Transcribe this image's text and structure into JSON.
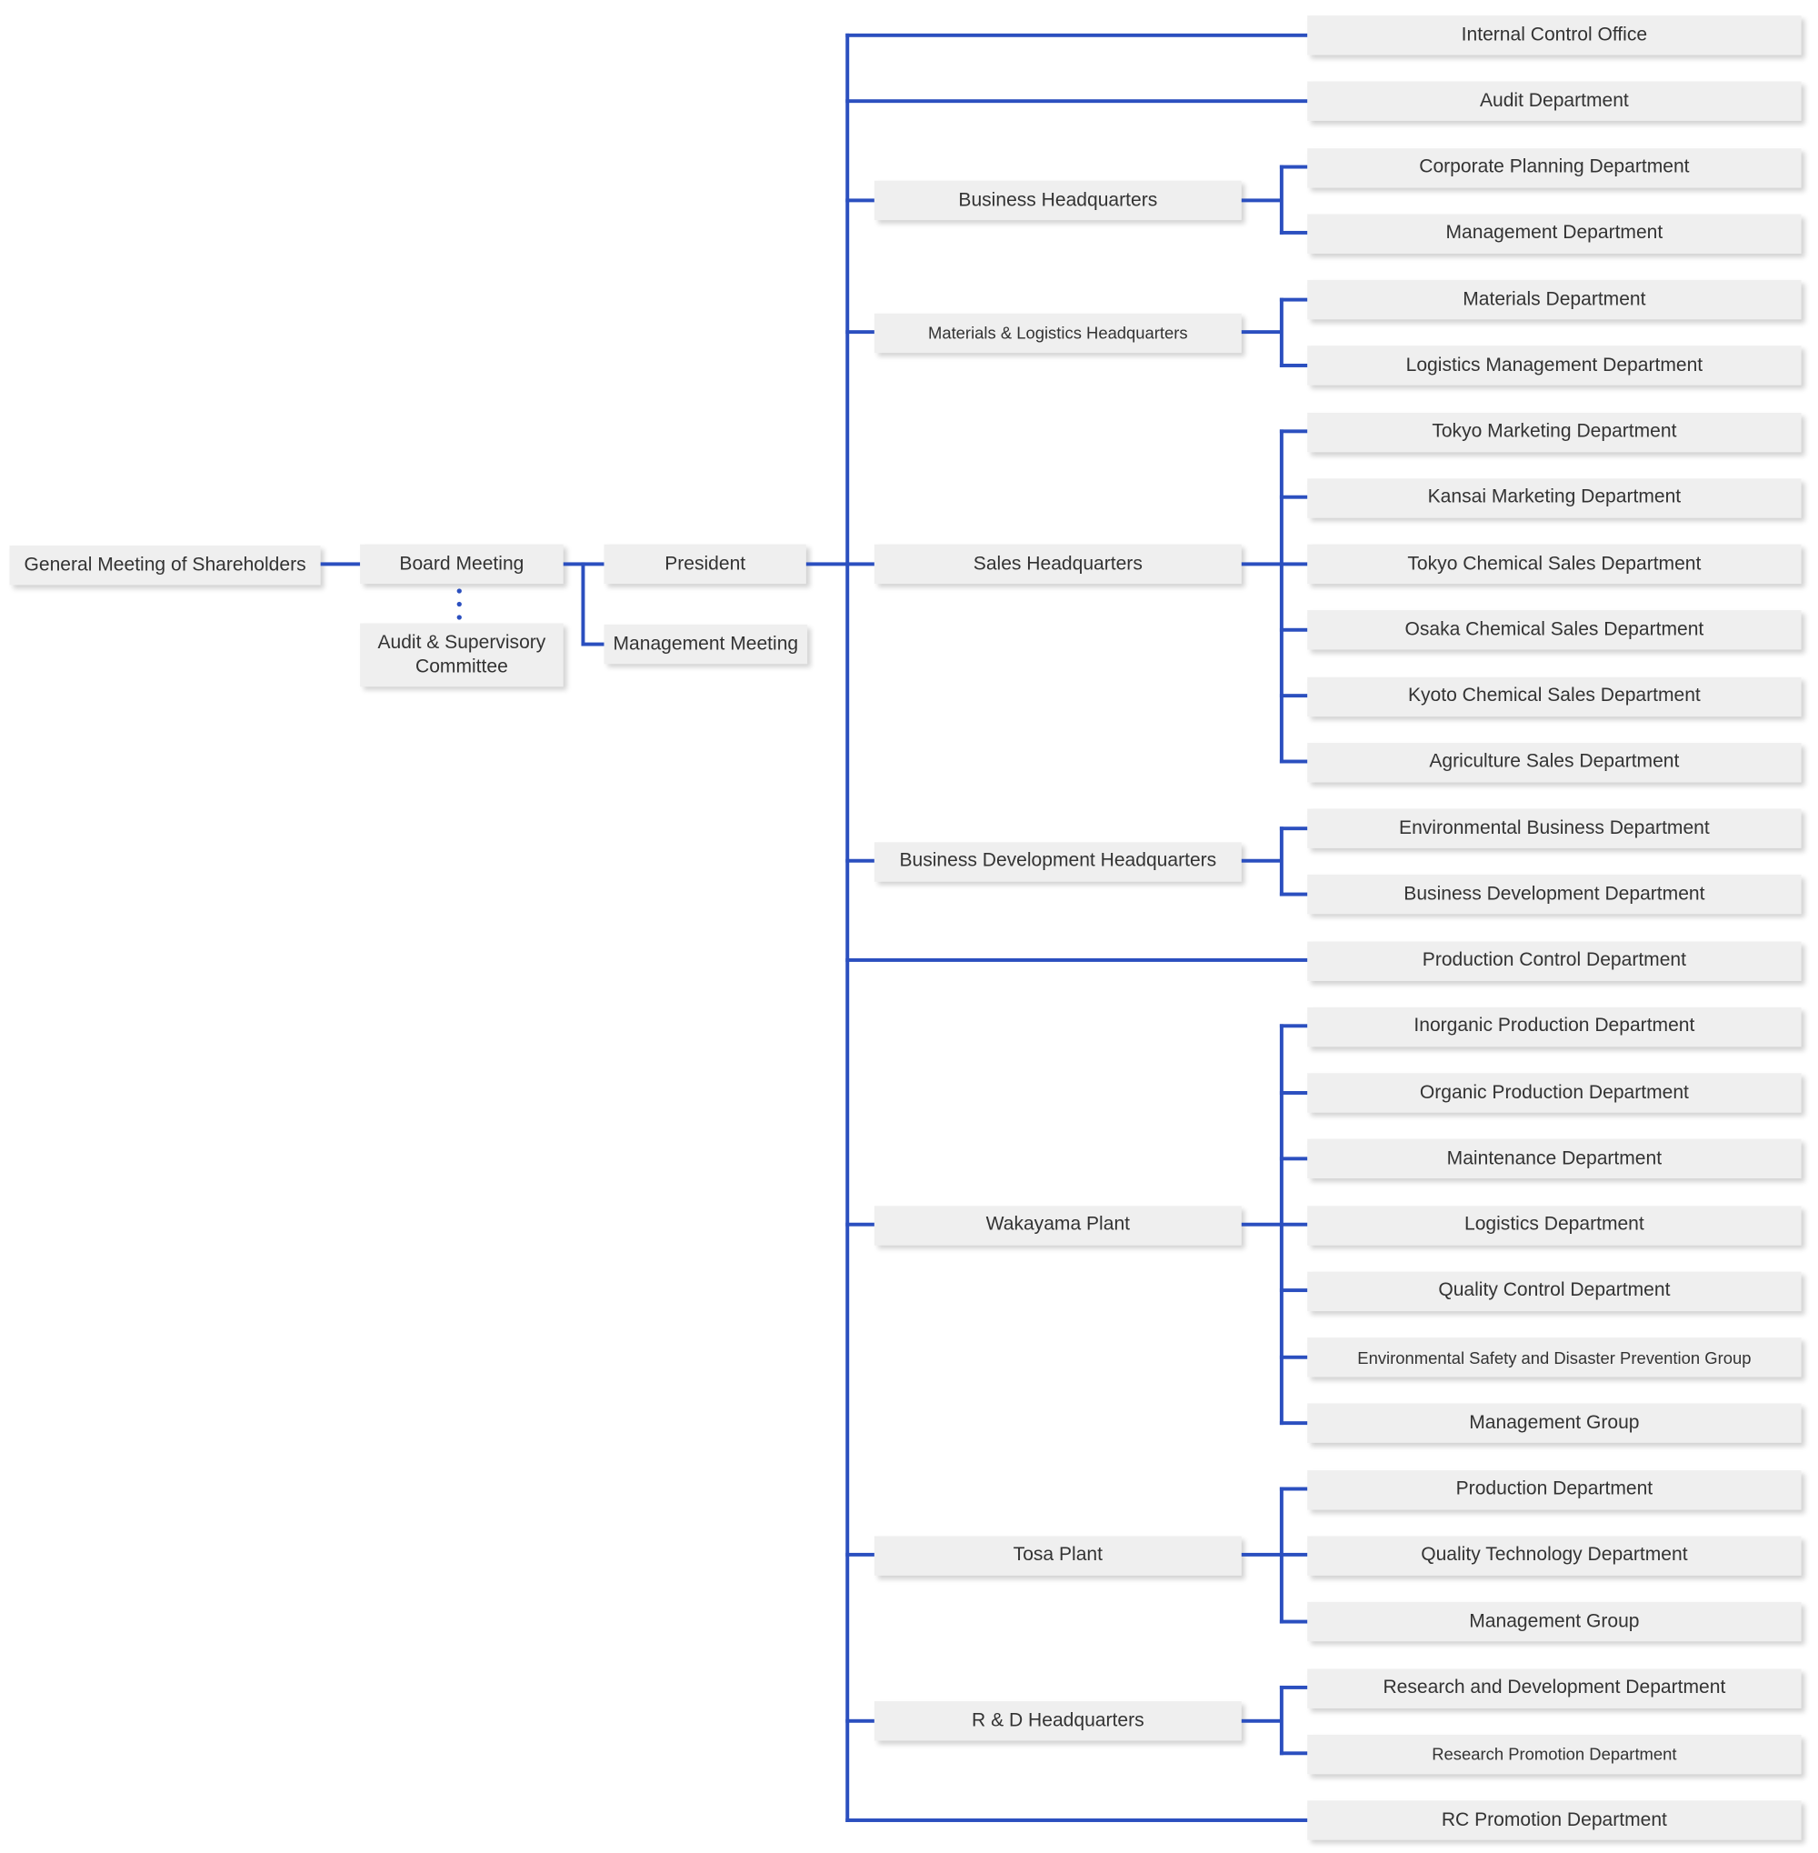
{
  "colors": {
    "line": "#2b4fbf",
    "box": "#efefef",
    "text": "#333333"
  },
  "left": {
    "shareholders": "General Meeting of Shareholders",
    "board": "Board Meeting",
    "audit_committee_line1": "Audit & Supervisory",
    "audit_committee_line2": "Committee",
    "president": "President",
    "management_meeting": "Management Meeting"
  },
  "branches": [
    {
      "label": "Internal Control Office"
    },
    {
      "label": "Audit Department"
    },
    {
      "label": "Business Headquarters",
      "children": [
        "Corporate Planning Department",
        "Management Department"
      ]
    },
    {
      "label": "Materials & Logistics Headquarters",
      "children": [
        "Materials Department",
        "Logistics Management Department"
      ]
    },
    {
      "label": "Sales Headquarters",
      "children": [
        "Tokyo Marketing Department",
        "Kansai Marketing Department",
        "Tokyo Chemical Sales Department",
        "Osaka Chemical Sales Department",
        "Kyoto Chemical Sales Department",
        "Agriculture Sales Department"
      ]
    },
    {
      "label": "Business Development Headquarters",
      "children": [
        "Environmental Business Department",
        "Business Development Department"
      ]
    },
    {
      "label": "Production Control Department"
    },
    {
      "label": "Wakayama Plant",
      "children": [
        "Inorganic Production Department",
        "Organic Production Department",
        "Maintenance Department",
        "Logistics Department",
        "Quality Control Department",
        "Environmental Safety and Disaster Prevention Group",
        "Management Group"
      ]
    },
    {
      "label": "Tosa Plant",
      "children": [
        "Production Department",
        "Quality Technology Department",
        "Management Group"
      ]
    },
    {
      "label": "R & D Headquarters",
      "children": [
        "Research and Development Department",
        "Research Promotion Department"
      ]
    },
    {
      "label": "RC Promotion Department"
    }
  ]
}
